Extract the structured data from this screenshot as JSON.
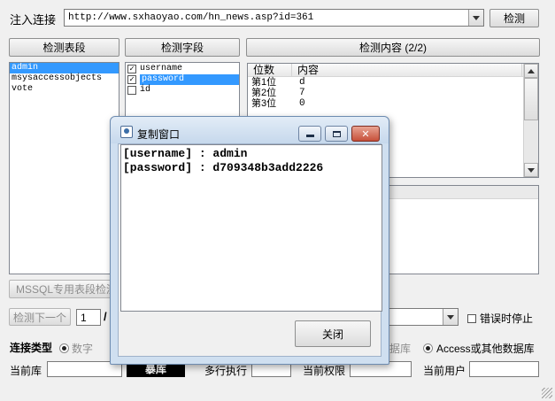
{
  "top_bar": {
    "label": "注入连接",
    "url": "http://www.sxhaoyao.com/hn_news.asp?id=361",
    "check_button": "检测"
  },
  "panels": {
    "tables_header": "检测表段",
    "fields_header": "检测字段",
    "content_header": "检测内容 (2/2)"
  },
  "tables": [
    "admin",
    "msysaccessobjects",
    "vote"
  ],
  "fields": [
    {
      "label": "username",
      "checked": true
    },
    {
      "label": "password",
      "checked": true
    },
    {
      "label": "id",
      "checked": false
    }
  ],
  "content_grid": {
    "columns": [
      "位数",
      "内容"
    ],
    "rows": [
      {
        "pos": "第1位",
        "val": "d"
      },
      {
        "pos": "第2位",
        "val": "7"
      },
      {
        "pos": "第3位",
        "val": "0"
      }
    ]
  },
  "mssql_button": "MSSQL专用表段检测",
  "next_button": "检测下一个",
  "page_num": "1",
  "page_sep": "/",
  "stop_on_error": "错误时停止",
  "conn_type": {
    "label": "连接类型",
    "numeric": "数字",
    "db_partial": "据库",
    "access": "Access或其他数据库"
  },
  "status_bar": {
    "current_db": "当前库",
    "dark_label": "暴库",
    "multi_exec": "多行执行",
    "current_perm": "当前权限",
    "current_user": "当前用户"
  },
  "dialog": {
    "title": "复制窗口",
    "lines": [
      "[username] : admin",
      "[password] : d709348b3add2226"
    ],
    "close_button": "关闭"
  }
}
